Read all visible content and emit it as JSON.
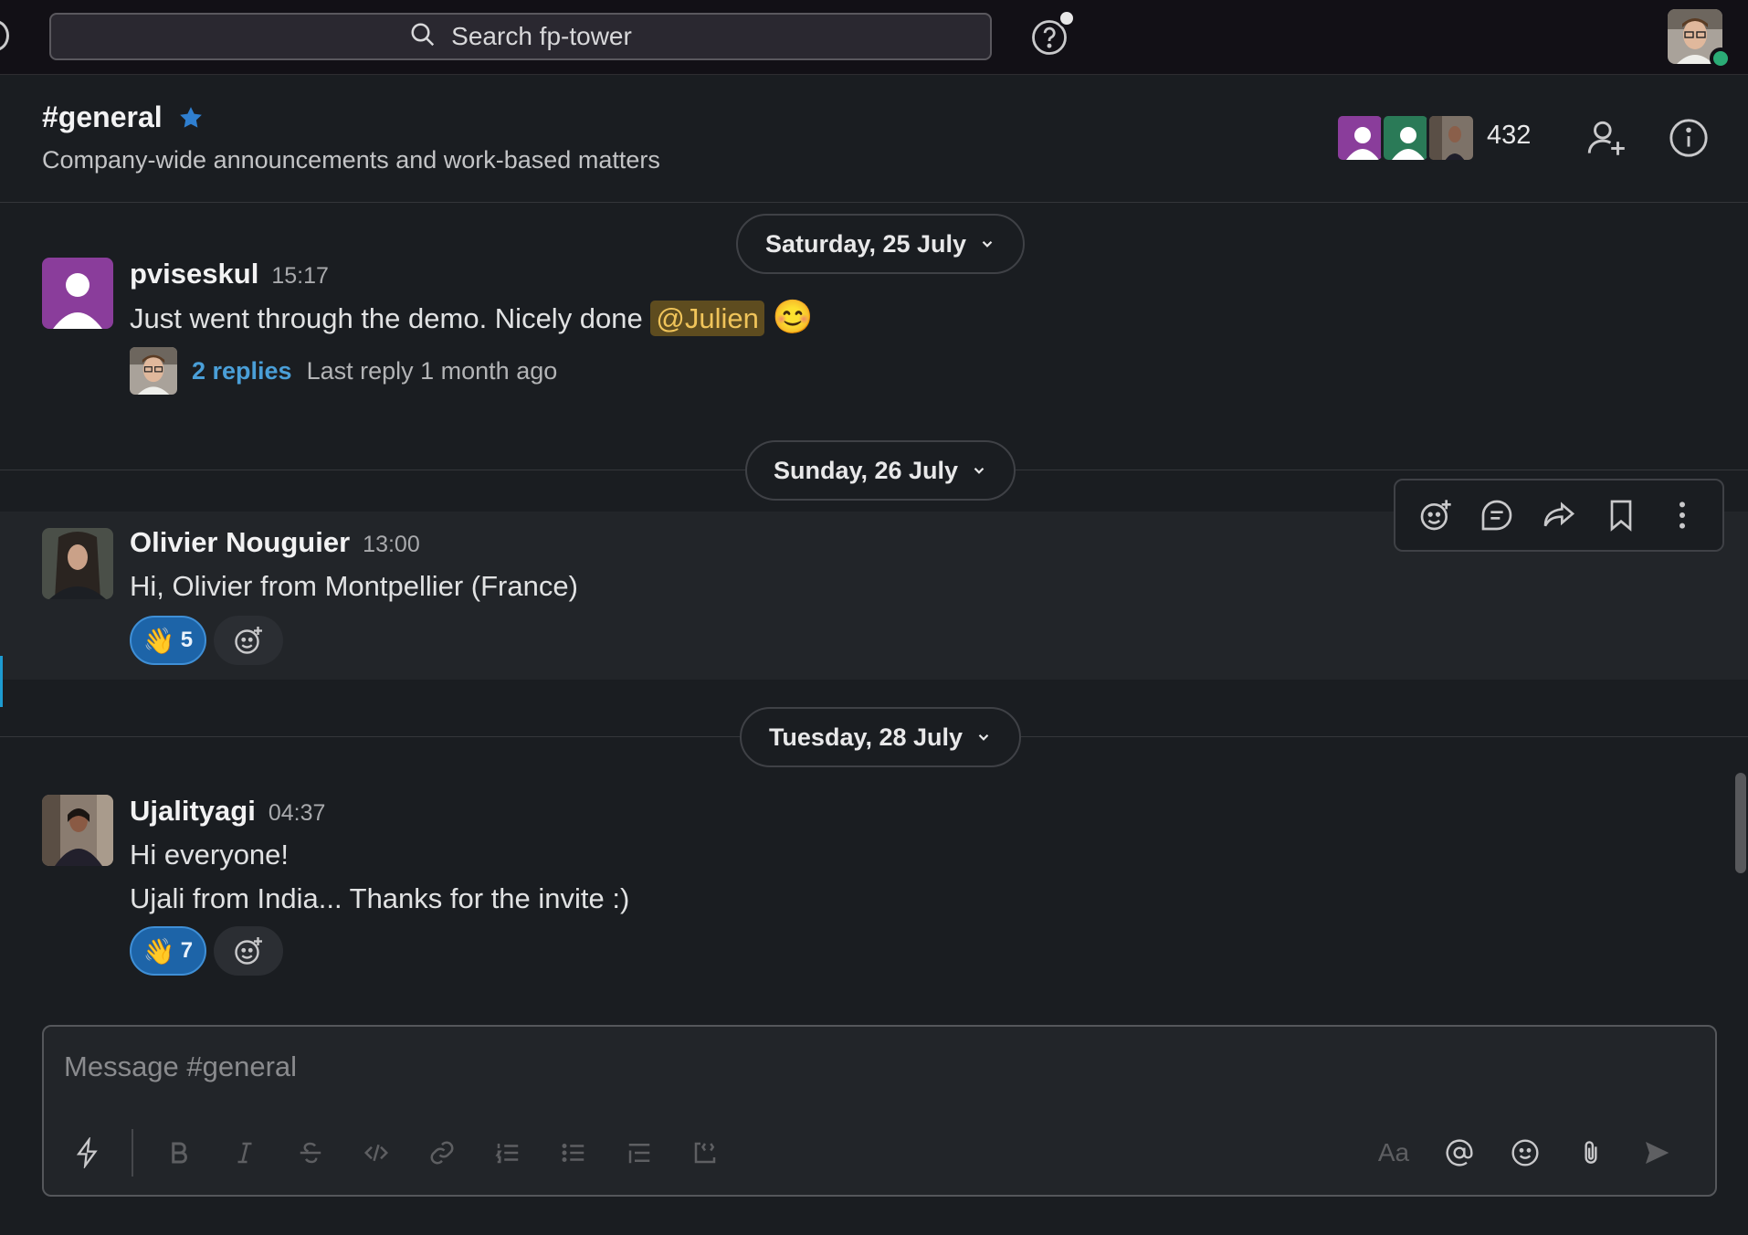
{
  "topbar": {
    "search_placeholder": "Search fp-tower"
  },
  "channel": {
    "name": "#general",
    "description": "Company-wide announcements and work-based matters",
    "member_count": "432"
  },
  "messages": [
    {
      "date": "Saturday, 25 July",
      "author": "pviseskul",
      "time": "15:17",
      "text_before": "Just went through the demo. Nicely done ",
      "mention": "@Julien",
      "emoji": "😊",
      "thread": {
        "replies": "2 replies",
        "last_reply": "Last reply 1 month ago"
      }
    },
    {
      "date": "Sunday, 26 July",
      "author": "Olivier Nouguier",
      "time": "13:00",
      "text": "Hi, Olivier from Montpellier (France)",
      "reaction": {
        "emoji": "👋",
        "count": "5"
      }
    },
    {
      "date": "Tuesday, 28 July",
      "author": "Ujalityagi",
      "time": "04:37",
      "lines": [
        "Hi everyone!",
        "Ujali from India... Thanks for the invite :)"
      ],
      "reaction": {
        "emoji": "👋",
        "count": "7"
      }
    }
  ],
  "composer": {
    "placeholder": "Message #general",
    "format_label": "Aa"
  },
  "icons": [
    "search-icon",
    "help-icon",
    "star-icon",
    "add-member-icon",
    "info-icon",
    "add-reaction-icon",
    "reply-in-thread-icon",
    "share-icon",
    "bookmark-icon",
    "more-icon",
    "shortcuts-icon",
    "bold-icon",
    "italic-icon",
    "strikethrough-icon",
    "code-icon",
    "link-icon",
    "ordered-list-icon",
    "bulleted-list-icon",
    "blockquote-icon",
    "code-block-icon",
    "mention-icon",
    "emoji-icon",
    "attach-icon",
    "send-icon"
  ],
  "colors": {
    "accent": "#1d64a8",
    "link": "#4a9fd8",
    "mention_bg": "#5e4c1f",
    "online": "#2bac76",
    "star": "#2f7fd0"
  }
}
